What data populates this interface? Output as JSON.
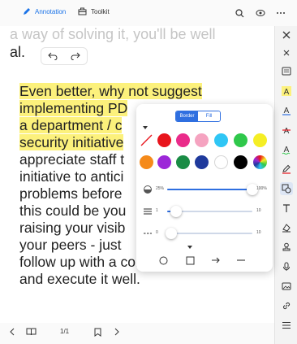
{
  "topbar": {
    "tabs": [
      {
        "label": "Annotation",
        "icon": "pen-icon",
        "active": true
      },
      {
        "label": "Toolkit",
        "icon": "toolbox-icon",
        "active": false
      }
    ],
    "right_icons": [
      "search-icon",
      "eye-icon",
      "more-icon"
    ]
  },
  "document": {
    "faded_line": "a way of solving it, you'll be well",
    "partial_line": "al.",
    "lines": [
      {
        "text": "Even better, why not suggest",
        "highlight": true
      },
      {
        "text": "implementing PD",
        "highlight": true
      },
      {
        "text": "a department / c",
        "highlight": true
      },
      {
        "text": "security initiative",
        "highlight": true
      },
      {
        "text": "appreciate staff t",
        "highlight": false
      },
      {
        "text": "initiative to antici",
        "highlight": false
      },
      {
        "text": "problems before",
        "highlight": false
      },
      {
        "text": "this could be you",
        "highlight": false
      },
      {
        "text": "raising your visib",
        "highlight": false
      },
      {
        "text": "your peers - just",
        "highlight": false
      },
      {
        "text": "follow up with a concrete plan",
        "highlight": false
      },
      {
        "text": "and execute it well.",
        "highlight": false
      }
    ]
  },
  "bottombar": {
    "page_indicator": "1/1"
  },
  "popover": {
    "tabs": {
      "border": "Border",
      "fill": "Fill"
    },
    "opacity": {
      "min": "25%",
      "max": "100%",
      "value_fraction": 1.0
    },
    "thickness": {
      "min": "1",
      "max": "10",
      "value_fraction": 0.1
    },
    "dash": {
      "min": "0",
      "max": "10",
      "value_fraction": 0.05
    },
    "colors": [
      "none",
      "#e8141c",
      "#ea2b8a",
      "#f5a3c0",
      "#2fc6f5",
      "#2fc84b",
      "#f5ee25",
      "#f58a1a",
      "#9c27d8",
      "#1a8c45",
      "#1f3a9c",
      "#ffffff",
      "#000000",
      "multicolor"
    ],
    "shapes": [
      "circle-icon",
      "square-icon",
      "arrow-icon",
      "line-icon"
    ]
  },
  "colors": {
    "accent": "#1a73e8",
    "highlight": "#fcf17c"
  }
}
